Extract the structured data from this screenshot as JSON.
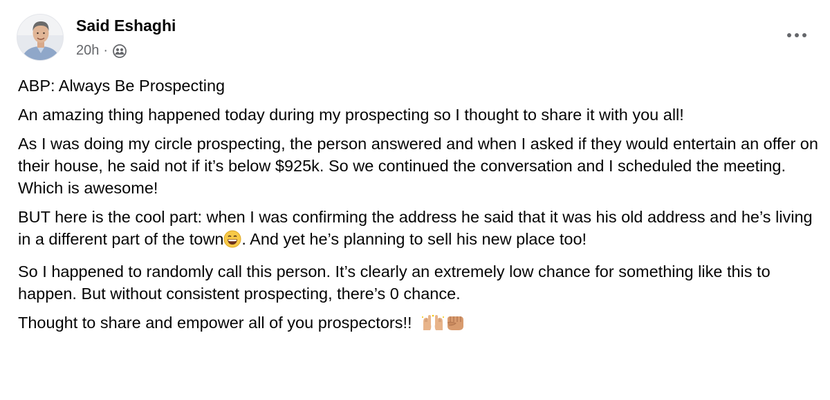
{
  "post": {
    "author_name": "Said Eshaghi",
    "timestamp": "20h",
    "separator": "·",
    "audience_icon": "friends-icon",
    "more_icon": "more-options-icon",
    "paragraphs": {
      "p1": "ABP: Always Be Prospecting",
      "p2": "An amazing thing happened today during my prospecting so I thought to share it with you all!",
      "p3": "As I was doing my circle prospecting, the person answered and when I asked if they would entertain an offer on their house, he said not if it’s below $925k. So we continued the conversation and I scheduled the meeting. Which is awesome!",
      "p4_before_emoji": "BUT here is the cool part: when I was confirming the address he said that it was his old address and he’s living in a different part of the town",
      "p4_emoji": "grinning-face-icon",
      "p4_after_emoji": ". And yet he’s planning to sell his new place too!",
      "p5": "So I happened to randomly call this person. It’s clearly an extremely low chance for something like this to happen. But without consistent prospecting, there’s 0 chance.",
      "p6": "Thought to share and empower all of you prospectors!!",
      "p6_emojis": [
        "raising-hands-icon",
        "fist-icon"
      ]
    }
  }
}
